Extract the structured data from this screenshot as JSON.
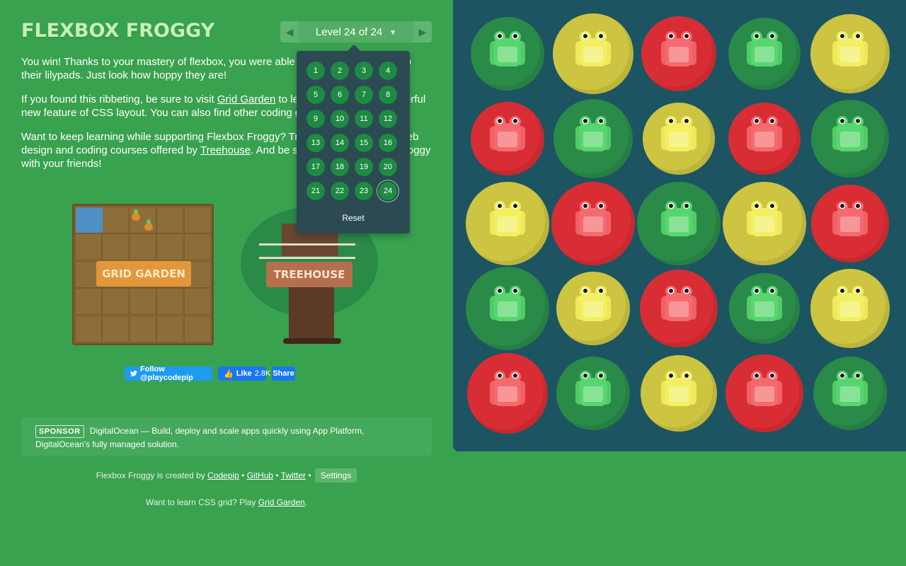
{
  "header": {
    "title": "FLEXBOX FROGGY",
    "level_indicator": "Level 24 of 24",
    "prev_icon": "triangle-left-icon",
    "next_icon": "triangle-right-icon",
    "caret_icon": "caret-down-icon"
  },
  "intro": {
    "p1": "You win! Thanks to your mastery of flexbox, you were able to help all of the frogs to their lilypads. Just look how hoppy they are!",
    "p2_before": "If you found this ribbeting, be sure to visit ",
    "p2_link": "Grid Garden",
    "p2_after": " to learn about another powerful new feature of CSS layout. You can also find other coding games at Codepip.",
    "p3_before": "Want to keep learning while supporting Flexbox Froggy? Try out the high-quality web design and coding courses offered by ",
    "p3_link": "Treehouse",
    "p3_after": ". And be sure to share Flexbox Froggy with your friends!"
  },
  "promos": {
    "grid_garden_label": "GRID GARDEN",
    "treehouse_label": "TREEHOUSE"
  },
  "social": {
    "twitter_label": "Follow @playcodepip",
    "like_label": "Like",
    "like_count": "2.8K",
    "share_label": "Share"
  },
  "sponsor": {
    "tag": "SPONSOR",
    "text": "DigitalOcean — Build, deploy and scale apps quickly using App Platform, DigitalOcean's fully managed solution."
  },
  "footer": {
    "created_by": "Flexbox Froggy is created by ",
    "codepip": "Codepip",
    "sep": " • ",
    "github": "GitHub",
    "twitter": "Twitter",
    "settings": "Settings",
    "learn_grid_before": "Want to learn CSS grid? Play ",
    "learn_grid_link": "Grid Garden",
    "learn_grid_after": "."
  },
  "level_menu": {
    "levels": [
      "1",
      "2",
      "3",
      "4",
      "5",
      "6",
      "7",
      "8",
      "9",
      "10",
      "11",
      "12",
      "13",
      "14",
      "15",
      "16",
      "17",
      "18",
      "19",
      "20",
      "21",
      "22",
      "23",
      "24"
    ],
    "current": "24",
    "reset_label": "Reset"
  },
  "board": {
    "rows": [
      [
        "green",
        "yellow",
        "red",
        "green",
        "yellow"
      ],
      [
        "red",
        "green",
        "yellow",
        "red",
        "green"
      ],
      [
        "yellow",
        "red",
        "green",
        "yellow",
        "red"
      ],
      [
        "green",
        "yellow",
        "red",
        "green",
        "yellow"
      ],
      [
        "red",
        "green",
        "yellow",
        "red",
        "green"
      ]
    ]
  },
  "colors": {
    "page_bg": "#39a24f",
    "board_bg": "#1c5462",
    "green_pad": "#2a8a48",
    "green_frog": "#58d66e",
    "yellow_pad": "#cdc541",
    "yellow_frog": "#f3ef60",
    "red_pad": "#d82d34",
    "red_frog": "#f56a6e"
  }
}
